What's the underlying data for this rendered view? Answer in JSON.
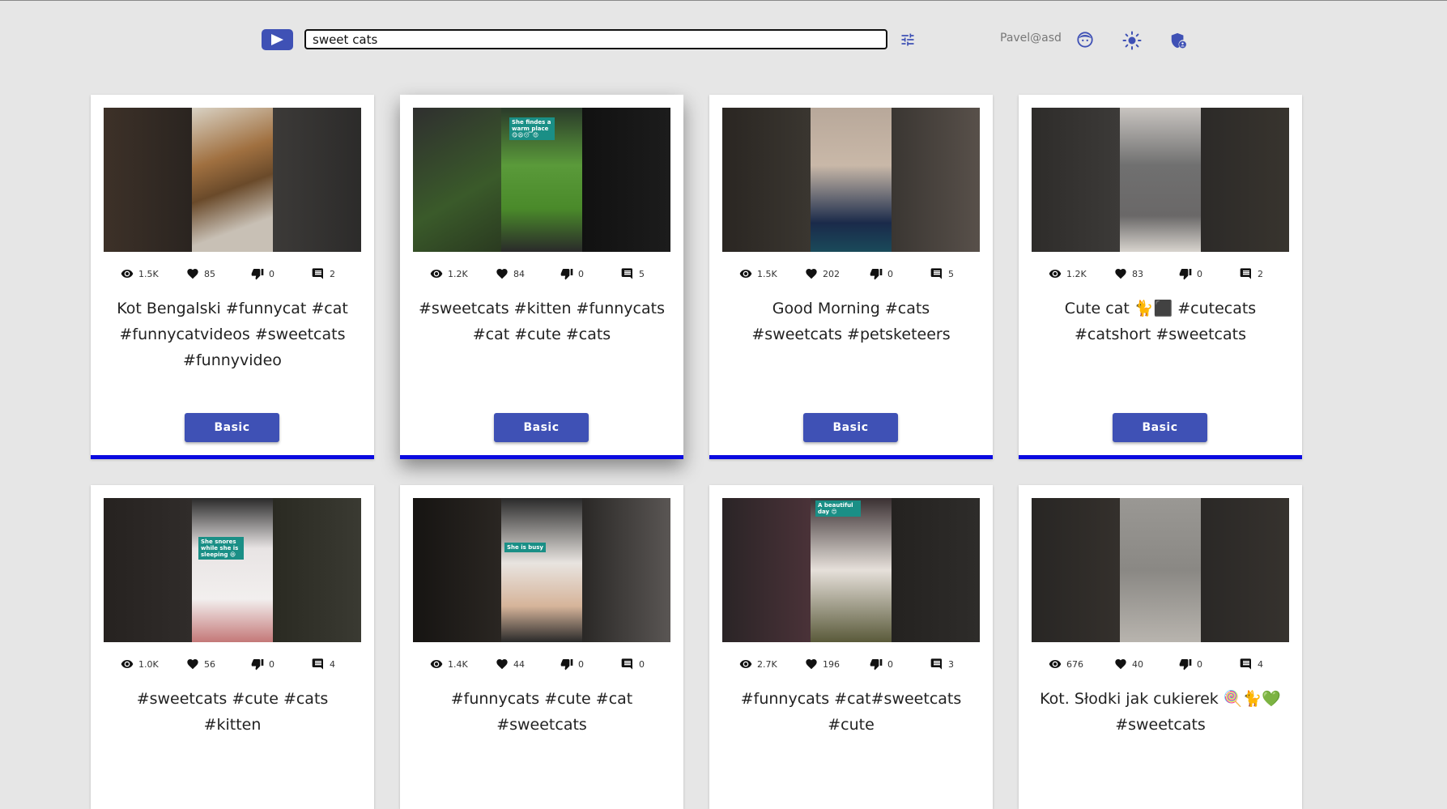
{
  "header": {
    "search_value": "sweet cats",
    "user_label": "Pavel@asd"
  },
  "cards": [
    {
      "views": "1.5K",
      "likes": "85",
      "dislikes": "0",
      "comments": "2",
      "title": "Kot Bengalski #funnycat #cat #funnycatvideos #sweetcats #funnyvideo",
      "button": "Basic"
    },
    {
      "views": "1.2K",
      "likes": "84",
      "dislikes": "0",
      "comments": "5",
      "title": "#sweetcats #kitten #funnycats #cat #cute #cats",
      "button": "Basic",
      "thumb_caption": "She findes a warm place 😋😫😴😍"
    },
    {
      "views": "1.5K",
      "likes": "202",
      "dislikes": "0",
      "comments": "5",
      "title": "Good Morning #cats #sweetcats #petsketeers",
      "button": "Basic"
    },
    {
      "views": "1.2K",
      "likes": "83",
      "dislikes": "0",
      "comments": "2",
      "title": "Cute cat 🐈⬛ #cutecats #catshort #sweetcats",
      "button": "Basic"
    },
    {
      "views": "1.0K",
      "likes": "56",
      "dislikes": "0",
      "comments": "4",
      "title": "#sweetcats #cute #cats #kitten",
      "button": "Basic",
      "thumb_caption": "She snores while she is sleeping 😆"
    },
    {
      "views": "1.4K",
      "likes": "44",
      "dislikes": "0",
      "comments": "0",
      "title": "#funnycats #cute #cat #sweetcats",
      "button": "Basic",
      "thumb_caption": "She is busy"
    },
    {
      "views": "2.7K",
      "likes": "196",
      "dislikes": "0",
      "comments": "3",
      "title": "#funnycats #cat#sweetcats #cute",
      "button": "Basic",
      "thumb_caption": "A beautiful day 😍"
    },
    {
      "views": "676",
      "likes": "40",
      "dislikes": "0",
      "comments": "4",
      "title": "Kot. Słodki jak cukierek 🍭🐈💚 #sweetcats",
      "button": "Basic"
    }
  ],
  "colors": {
    "accent": "#3f51b5",
    "card_border": "#0a0ae0",
    "background": "#e6e6e6"
  },
  "icons": {
    "play": "play-icon",
    "tune": "tune-icon",
    "avatar": "face-icon",
    "theme": "sun-icon",
    "admin": "admin-shield-icon",
    "views": "eye-icon",
    "likes": "heart-icon",
    "dislikes": "thumb-down-icon",
    "comments": "comment-icon"
  }
}
